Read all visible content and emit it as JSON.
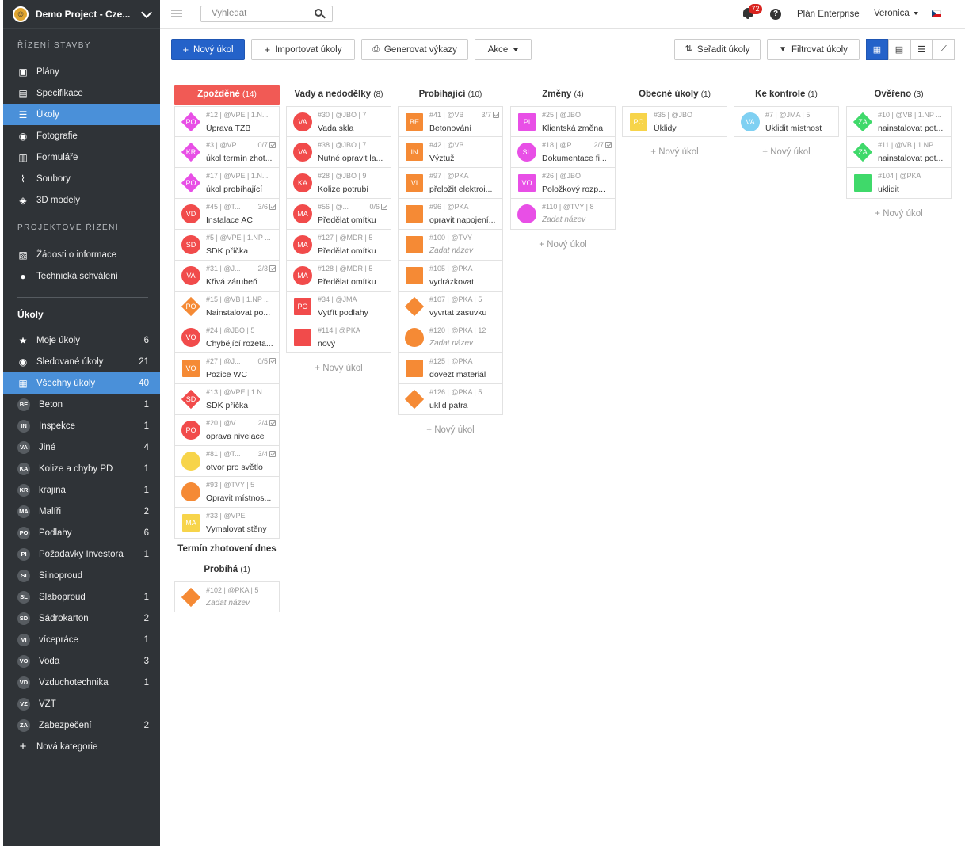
{
  "project": {
    "name": "Demo Project - Cze..."
  },
  "sections": {
    "construction": "ŘÍZENÍ STAVBY",
    "project_mgmt": "PROJEKTOVÉ ŘÍZENÍ",
    "tasks": "Úkoly"
  },
  "nav_construction": [
    {
      "label": "Plány",
      "icon": "plans-icon"
    },
    {
      "label": "Specifikace",
      "icon": "specification-icon"
    },
    {
      "label": "Úkoly",
      "icon": "list-icon"
    },
    {
      "label": "Fotografie",
      "icon": "camera-icon"
    },
    {
      "label": "Formuláře",
      "icon": "form-icon"
    },
    {
      "label": "Soubory",
      "icon": "paperclip-icon"
    },
    {
      "label": "3D modely",
      "icon": "cube-icon"
    }
  ],
  "nav_project": [
    {
      "label": "Žádosti o informace",
      "icon": "document-icon"
    },
    {
      "label": "Technická schválení",
      "icon": "person-icon"
    }
  ],
  "nav_tasks": [
    {
      "label": "Moje úkoly",
      "count": "6",
      "icon": "star-icon"
    },
    {
      "label": "Sledované úkoly",
      "count": "21",
      "icon": "eye-icon"
    },
    {
      "label": "Všechny úkoly",
      "count": "40",
      "icon": "grid-icon"
    }
  ],
  "categories": [
    {
      "code": "BE",
      "label": "Beton",
      "count": "1"
    },
    {
      "code": "IN",
      "label": "Inspekce",
      "count": "1"
    },
    {
      "code": "VA",
      "label": "Jiné",
      "count": "4"
    },
    {
      "code": "KA",
      "label": "Kolize a chyby PD",
      "count": "1"
    },
    {
      "code": "KR",
      "label": "krajina",
      "count": "1"
    },
    {
      "code": "MA",
      "label": "Malíři",
      "count": "2"
    },
    {
      "code": "PO",
      "label": "Podlahy",
      "count": "6"
    },
    {
      "code": "PI",
      "label": "Požadavky Investora",
      "count": "1"
    },
    {
      "code": "SI",
      "label": "Silnoproud",
      "count": ""
    },
    {
      "code": "SL",
      "label": "Slaboproud",
      "count": "1"
    },
    {
      "code": "SD",
      "label": "Sádrokarton",
      "count": "2"
    },
    {
      "code": "VI",
      "label": "vícepráce",
      "count": "1"
    },
    {
      "code": "VO",
      "label": "Voda",
      "count": "3"
    },
    {
      "code": "VD",
      "label": "Vzduchotechnika",
      "count": "1"
    },
    {
      "code": "VZ",
      "label": "VZT",
      "count": ""
    },
    {
      "code": "ZA",
      "label": "Zabezpečení",
      "count": "2"
    }
  ],
  "new_category": "Nová kategorie",
  "topbar": {
    "search_placeholder": "Vyhledat",
    "notifications": "72",
    "help": "?",
    "plan": "Plán Enterprise",
    "user": "Veronica"
  },
  "toolbar": {
    "new_task": "Nový úkol",
    "import": "Importovat úkoly",
    "reports": "Generovat výkazy",
    "actions": "Akce",
    "sort": "Seřadit úkoly",
    "filter": "Filtrovat úkoly"
  },
  "add_task": "+ Nový úkol",
  "colors": {
    "late": "#f15a55",
    "primary": "#2462c9",
    "sidebar": "#2f3337",
    "active": "#4a90d9"
  },
  "columns": [
    {
      "title": "Zpožděné",
      "count": "(14)",
      "late": true,
      "add": false,
      "cards": [
        {
          "meta": "#12 | @VPE | 1.N...",
          "title": "Úprava TZB",
          "code": "PO",
          "shape": "diamond",
          "color": "#e84fe6"
        },
        {
          "meta": "#3 | @VP...",
          "cnt": "0/7",
          "title": "úkol termín zhot...",
          "code": "KR",
          "shape": "diamond",
          "color": "#e84fe6"
        },
        {
          "meta": "#17 | @VPE | 1.N...",
          "title": "úkol probíhající",
          "code": "PO",
          "shape": "diamond",
          "color": "#e84fe6"
        },
        {
          "meta": "#45 | @T...",
          "cnt": "3/6",
          "title": "Instalace AC",
          "code": "VD",
          "shape": "pin",
          "color": "#f14b4b"
        },
        {
          "meta": "#5 | @VPE | 1.NP ...",
          "title": "SDK příčka",
          "code": "SD",
          "shape": "pin",
          "color": "#f14b4b"
        },
        {
          "meta": "#31 | @J...",
          "cnt": "2/3",
          "title": "Křivá zárubeň",
          "code": "VA",
          "shape": "pin",
          "color": "#f14b4b"
        },
        {
          "meta": "#15 | @VB | 1.NP ...",
          "title": "Nainstalovat po...",
          "code": "PO",
          "shape": "diamond",
          "color": "#f58a35"
        },
        {
          "meta": "#24 | @JBO | 5",
          "title": "Chybějící rozeta...",
          "code": "VO",
          "shape": "pin",
          "color": "#f14b4b"
        },
        {
          "meta": "#27 | @J...",
          "cnt": "0/5",
          "title": "Pozice WC",
          "code": "VO",
          "shape": "square",
          "color": "#f58a35"
        },
        {
          "meta": "#13 | @VPE | 1.N...",
          "title": "SDK příčka",
          "code": "SD",
          "shape": "diamond",
          "color": "#f14b4b"
        },
        {
          "meta": "#20 | @V...",
          "cnt": "2/4",
          "title": "oprava nivelace",
          "code": "PO",
          "shape": "pin",
          "color": "#f14b4b"
        },
        {
          "meta": "#81 | @T...",
          "cnt": "3/4",
          "title": "otvor pro světlo",
          "code": "",
          "shape": "drop",
          "color": "#f7d44a"
        },
        {
          "meta": "#93 | @TVY | 5",
          "title": "Opravit místnos...",
          "code": "",
          "shape": "drop",
          "color": "#f58a35"
        },
        {
          "meta": "#33 | @VPE",
          "title": "Vymalovat stěny",
          "code": "MA",
          "shape": "square",
          "color": "#f7d44a"
        }
      ],
      "sub": [
        {
          "title": "Termín zhotovení dnes",
          "count": ""
        },
        {
          "title": "Probíhá",
          "count": "(1)"
        }
      ],
      "sub_cards": [
        {
          "meta": "#102 | @PKA | 5",
          "title": "Zadat název",
          "ph": true,
          "code": "",
          "shape": "diamond",
          "color": "#f58a35"
        }
      ]
    },
    {
      "title": "Vady a nedodělky",
      "count": "(8)",
      "add": true,
      "cards": [
        {
          "meta": "#30 | @JBO | 7",
          "title": "Vada skla",
          "code": "VA",
          "shape": "pin",
          "color": "#f14b4b"
        },
        {
          "meta": "#38 | @JBO | 7",
          "title": "Nutné opravit la...",
          "code": "VA",
          "shape": "pin",
          "color": "#f14b4b"
        },
        {
          "meta": "#28 | @JBO | 9",
          "title": "Kolize potrubí",
          "code": "KA",
          "shape": "pin",
          "color": "#f14b4b"
        },
        {
          "meta": "#56 | @...",
          "cnt": "0/6",
          "title": "Předělat omítku",
          "code": "MA",
          "shape": "pin",
          "color": "#f14b4b"
        },
        {
          "meta": "#127 | @MDR | 5",
          "title": "Předělat omítku",
          "code": "MA",
          "shape": "pin",
          "color": "#f14b4b"
        },
        {
          "meta": "#128 | @MDR | 5",
          "title": "Předělat omítku",
          "code": "MA",
          "shape": "pin",
          "color": "#f14b4b"
        },
        {
          "meta": "#34 | @JMA",
          "title": "Vytřít podlahy",
          "code": "PO",
          "shape": "square",
          "color": "#f14b4b"
        },
        {
          "meta": "#114 | @PKA",
          "title": "nový",
          "code": "",
          "shape": "square",
          "color": "#f14b4b"
        }
      ]
    },
    {
      "title": "Probíhající",
      "count": "(10)",
      "add": true,
      "cards": [
        {
          "meta": "#41 | @VB",
          "cnt": "3/7",
          "title": "Betonování",
          "code": "BE",
          "shape": "square",
          "color": "#f58a35"
        },
        {
          "meta": "#42 | @VB",
          "title": "Výztuž",
          "code": "IN",
          "shape": "square",
          "color": "#f58a35"
        },
        {
          "meta": "#97 | @PKA",
          "title": "přeložit elektroi...",
          "code": "VI",
          "shape": "square",
          "color": "#f58a35"
        },
        {
          "meta": "#96 | @PKA",
          "title": "opravit napojení...",
          "code": "",
          "shape": "square",
          "color": "#f58a35"
        },
        {
          "meta": "#100 | @TVY",
          "title": "Zadat název",
          "ph": true,
          "code": "",
          "shape": "square",
          "color": "#f58a35"
        },
        {
          "meta": "#105 | @PKA",
          "title": "vydrázkovat",
          "code": "",
          "shape": "square",
          "color": "#f58a35"
        },
        {
          "meta": "#107 | @PKA | 5",
          "title": "vyvrtat zasuvku",
          "code": "",
          "shape": "diamond",
          "color": "#f58a35"
        },
        {
          "meta": "#120 | @PKA | 12",
          "title": "Zadat název",
          "ph": true,
          "code": "",
          "shape": "drop",
          "color": "#f58a35"
        },
        {
          "meta": "#125 | @PKA",
          "title": "dovezt materiál",
          "code": "",
          "shape": "square",
          "color": "#f58a35"
        },
        {
          "meta": "#126 | @PKA | 5",
          "title": "uklid patra",
          "code": "",
          "shape": "diamond",
          "color": "#f58a35"
        }
      ]
    },
    {
      "title": "Změny",
      "count": "(4)",
      "add": true,
      "cards": [
        {
          "meta": "#25 | @JBO",
          "title": "Klientská změna",
          "code": "PI",
          "shape": "square",
          "color": "#e84fe6"
        },
        {
          "meta": "#18 | @P...",
          "cnt": "2/7",
          "title": "Dokumentace fi...",
          "code": "SL",
          "shape": "pin",
          "color": "#e84fe6"
        },
        {
          "meta": "#26 | @JBO",
          "title": "Položkový rozp...",
          "code": "VO",
          "shape": "square",
          "color": "#e84fe6"
        },
        {
          "meta": "#110 | @TVY | 8",
          "title": "Zadat název",
          "ph": true,
          "code": "",
          "shape": "drop",
          "color": "#e84fe6"
        }
      ]
    },
    {
      "title": "Obecné úkoly",
      "count": "(1)",
      "add": true,
      "cards": [
        {
          "meta": "#35 | @JBO",
          "title": "Úklidy",
          "code": "PO",
          "shape": "square",
          "color": "#f7d44a"
        }
      ]
    },
    {
      "title": "Ke kontrole",
      "count": "(1)",
      "add": true,
      "cards": [
        {
          "meta": "#7 | @JMA | 5",
          "title": "Uklidit místnost",
          "code": "VA",
          "shape": "pin",
          "color": "#7fd0f2"
        }
      ]
    },
    {
      "title": "Ověřeno",
      "count": "(3)",
      "add": true,
      "cards": [
        {
          "meta": "#10 | @VB | 1.NP ...",
          "title": "nainstalovat pot...",
          "code": "ZA",
          "shape": "diamond",
          "color": "#3fd96a"
        },
        {
          "meta": "#11 | @VB | 1.NP ...",
          "title": "nainstalovat pot...",
          "code": "ZA",
          "shape": "diamond",
          "color": "#3fd96a"
        },
        {
          "meta": "#104 | @PKA",
          "title": "uklidit",
          "code": "",
          "shape": "square",
          "color": "#3fd96a"
        }
      ]
    }
  ]
}
